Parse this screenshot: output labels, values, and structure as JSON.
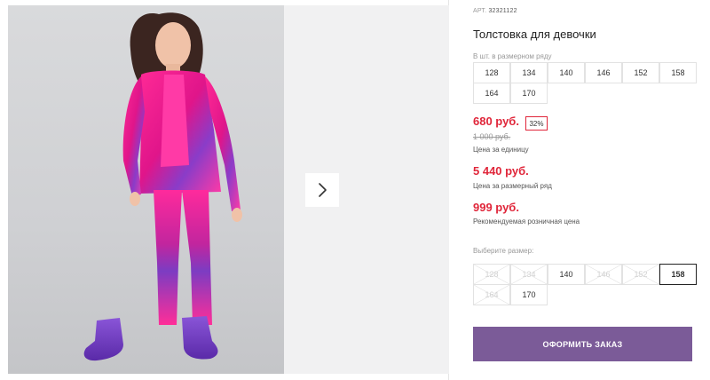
{
  "gallery": {
    "next_icon": "chevron-right-icon"
  },
  "product": {
    "article_label": "АРТ.",
    "article_number": "32321122",
    "title": "Толстовка для девочки",
    "row_sizes_label": "В шт. в размерном ряду",
    "row_sizes": [
      "128",
      "134",
      "140",
      "146",
      "152",
      "158",
      "164",
      "170"
    ],
    "unit_price": "680 руб.",
    "discount_badge": "32%",
    "old_price": "1 000 руб.",
    "unit_price_note": "Цена за единицу",
    "row_price": "5 440 руб.",
    "row_price_note": "Цена за размерный ряд",
    "retail_price": "999 руб.",
    "retail_price_note": "Рекомендуемая розничная цена",
    "size_select_label": "Выберите размер:",
    "sizes": [
      {
        "label": "128",
        "available": false,
        "selected": false
      },
      {
        "label": "134",
        "available": false,
        "selected": false
      },
      {
        "label": "140",
        "available": true,
        "selected": false
      },
      {
        "label": "146",
        "available": false,
        "selected": false
      },
      {
        "label": "152",
        "available": false,
        "selected": false
      },
      {
        "label": "158",
        "available": true,
        "selected": true
      },
      {
        "label": "164",
        "available": false,
        "selected": false
      },
      {
        "label": "170",
        "available": true,
        "selected": false
      }
    ],
    "order_button": "ОФОРМИТЬ ЗАКАЗ"
  },
  "colors": {
    "price_red": "#e0263a",
    "button_purple": "#7b5b98",
    "outfit_pink": "#ff1f8e",
    "outfit_purple": "#7a3fc4"
  }
}
